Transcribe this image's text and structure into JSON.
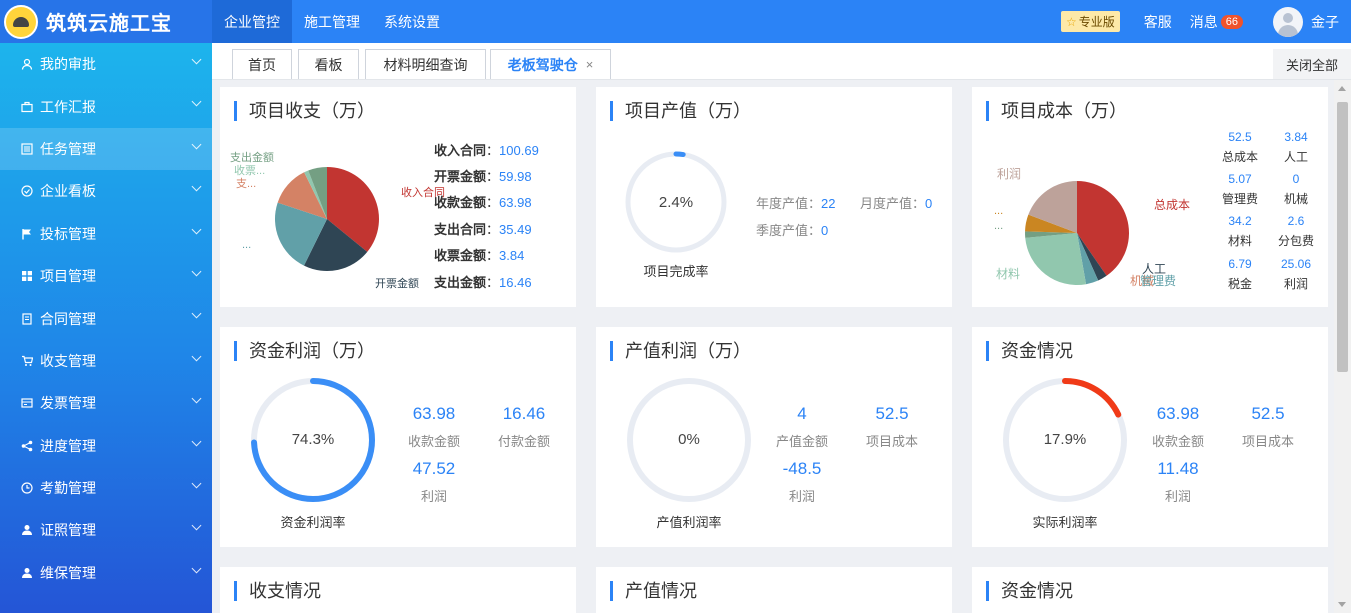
{
  "brand": {
    "name": "筑筑云施工宝"
  },
  "topnav": [
    {
      "label": "企业管控",
      "active": true
    },
    {
      "label": "施工管理"
    },
    {
      "label": "系统设置"
    }
  ],
  "topright": {
    "pro_label": "专业版",
    "service": "客服",
    "message": "消息",
    "message_count": "66",
    "user": "金子"
  },
  "sidebar": {
    "items": [
      {
        "label": "我的审批",
        "icon": "user-icon"
      },
      {
        "label": "工作汇报",
        "icon": "briefcase-icon"
      },
      {
        "label": "任务管理",
        "icon": "list-icon"
      },
      {
        "label": "企业看板",
        "icon": "check-circle-icon"
      },
      {
        "label": "投标管理",
        "icon": "flag-icon"
      },
      {
        "label": "项目管理",
        "icon": "grid-icon"
      },
      {
        "label": "合同管理",
        "icon": "document-icon"
      },
      {
        "label": "收支管理",
        "icon": "cart-icon"
      },
      {
        "label": "发票管理",
        "icon": "invoice-icon"
      },
      {
        "label": "进度管理",
        "icon": "share-icon"
      },
      {
        "label": "考勤管理",
        "icon": "clock-icon"
      },
      {
        "label": "证照管理",
        "icon": "person-icon"
      },
      {
        "label": "维保管理",
        "icon": "person-icon"
      }
    ]
  },
  "tabs": [
    {
      "label": "首页"
    },
    {
      "label": "看板"
    },
    {
      "label": "材料明细查询"
    },
    {
      "label": "老板驾驶仓",
      "active": true,
      "close": "×"
    }
  ],
  "close_all": "关闭全部",
  "cards": {
    "income": {
      "title": "项目收支（万）",
      "rows": [
        {
          "label": "收入合同",
          "value": "100.69"
        },
        {
          "label": "开票金额",
          "value": "59.98"
        },
        {
          "label": "收款金额",
          "value": "63.98"
        },
        {
          "label": "支出合同",
          "value": "35.49"
        },
        {
          "label": "收票金额",
          "value": "3.84"
        },
        {
          "label": "支出金额",
          "value": "16.46"
        }
      ],
      "pie_labels": [
        "支出金额",
        "收票...",
        "支...",
        "收入合同",
        "...",
        "开票金额"
      ]
    },
    "output": {
      "title": "项目产值（万）",
      "ring_value": "2.4%",
      "ring_caption": "项目完成率",
      "annual_label": "年度产值",
      "annual_value": "22",
      "monthly_label": "月度产值",
      "monthly_value": "0",
      "quarter_label": "季度产值",
      "quarter_value": "0"
    },
    "cost": {
      "title": "项目成本（万）",
      "pie_labels": [
        "利润",
        "总成本",
        "...",
        "...",
        "材料",
        "人工",
        "机械",
        "管理费"
      ],
      "grid": [
        {
          "value": "52.5",
          "label": "总成本"
        },
        {
          "value": "3.84",
          "label": "人工"
        },
        {
          "value": "5.07",
          "label": "管理费"
        },
        {
          "value": "0",
          "label": "机械"
        },
        {
          "value": "34.2",
          "label": "材料"
        },
        {
          "value": "2.6",
          "label": "分包费"
        },
        {
          "value": "6.79",
          "label": "税金"
        },
        {
          "value": "25.06",
          "label": "利润"
        }
      ]
    },
    "fund_profit": {
      "title": "资金利润（万）",
      "ring_value": "74.3%",
      "ring_caption": "资金利润率",
      "ring_fraction": 0.743,
      "stats": [
        {
          "value": "63.98",
          "label": "收款金额"
        },
        {
          "value": "16.46",
          "label": "付款金额"
        },
        {
          "value": "47.52",
          "label": "利润"
        }
      ]
    },
    "output_profit": {
      "title": "产值利润（万）",
      "ring_value": "0%",
      "ring_caption": "产值利润率",
      "ring_fraction": 0,
      "stats": [
        {
          "value": "4",
          "label": "产值金额"
        },
        {
          "value": "52.5",
          "label": "项目成本"
        },
        {
          "value": "-48.5",
          "label": "利润"
        }
      ]
    },
    "fund_status": {
      "title": "资金情况",
      "ring_value": "17.9%",
      "ring_caption": "实际利润率",
      "ring_fraction": 0.179,
      "stats": [
        {
          "value": "63.98",
          "label": "收款金额"
        },
        {
          "value": "52.5",
          "label": "项目成本"
        },
        {
          "value": "11.48",
          "label": "利润"
        }
      ]
    },
    "bottom": [
      {
        "title": "收支情况"
      },
      {
        "title": "产值情况"
      },
      {
        "title": "资金情况"
      }
    ]
  },
  "chart_data": [
    {
      "type": "pie",
      "categories": [
        "收入合同",
        "开票金额",
        "收款金额",
        "支出合同",
        "收票金额",
        "支出金额"
      ],
      "values": [
        100.69,
        59.98,
        63.98,
        35.49,
        3.84,
        16.46
      ],
      "colors": [
        "#c23531",
        "#2f4554",
        "#61a0a8",
        "#d48265",
        "#91c7ae",
        "#749f83"
      ]
    },
    {
      "type": "pie",
      "categories": [
        "总成本",
        "人工",
        "管理费",
        "机械",
        "材料",
        "分包费",
        "税金",
        "利润"
      ],
      "values": [
        52.5,
        3.84,
        5.07,
        0,
        34.2,
        2.6,
        6.79,
        25.06
      ],
      "colors": [
        "#c23531",
        "#2f4554",
        "#61a0a8",
        "#d48265",
        "#91c7ae",
        "#749f83",
        "#ca8622",
        "#bda29a"
      ]
    }
  ]
}
